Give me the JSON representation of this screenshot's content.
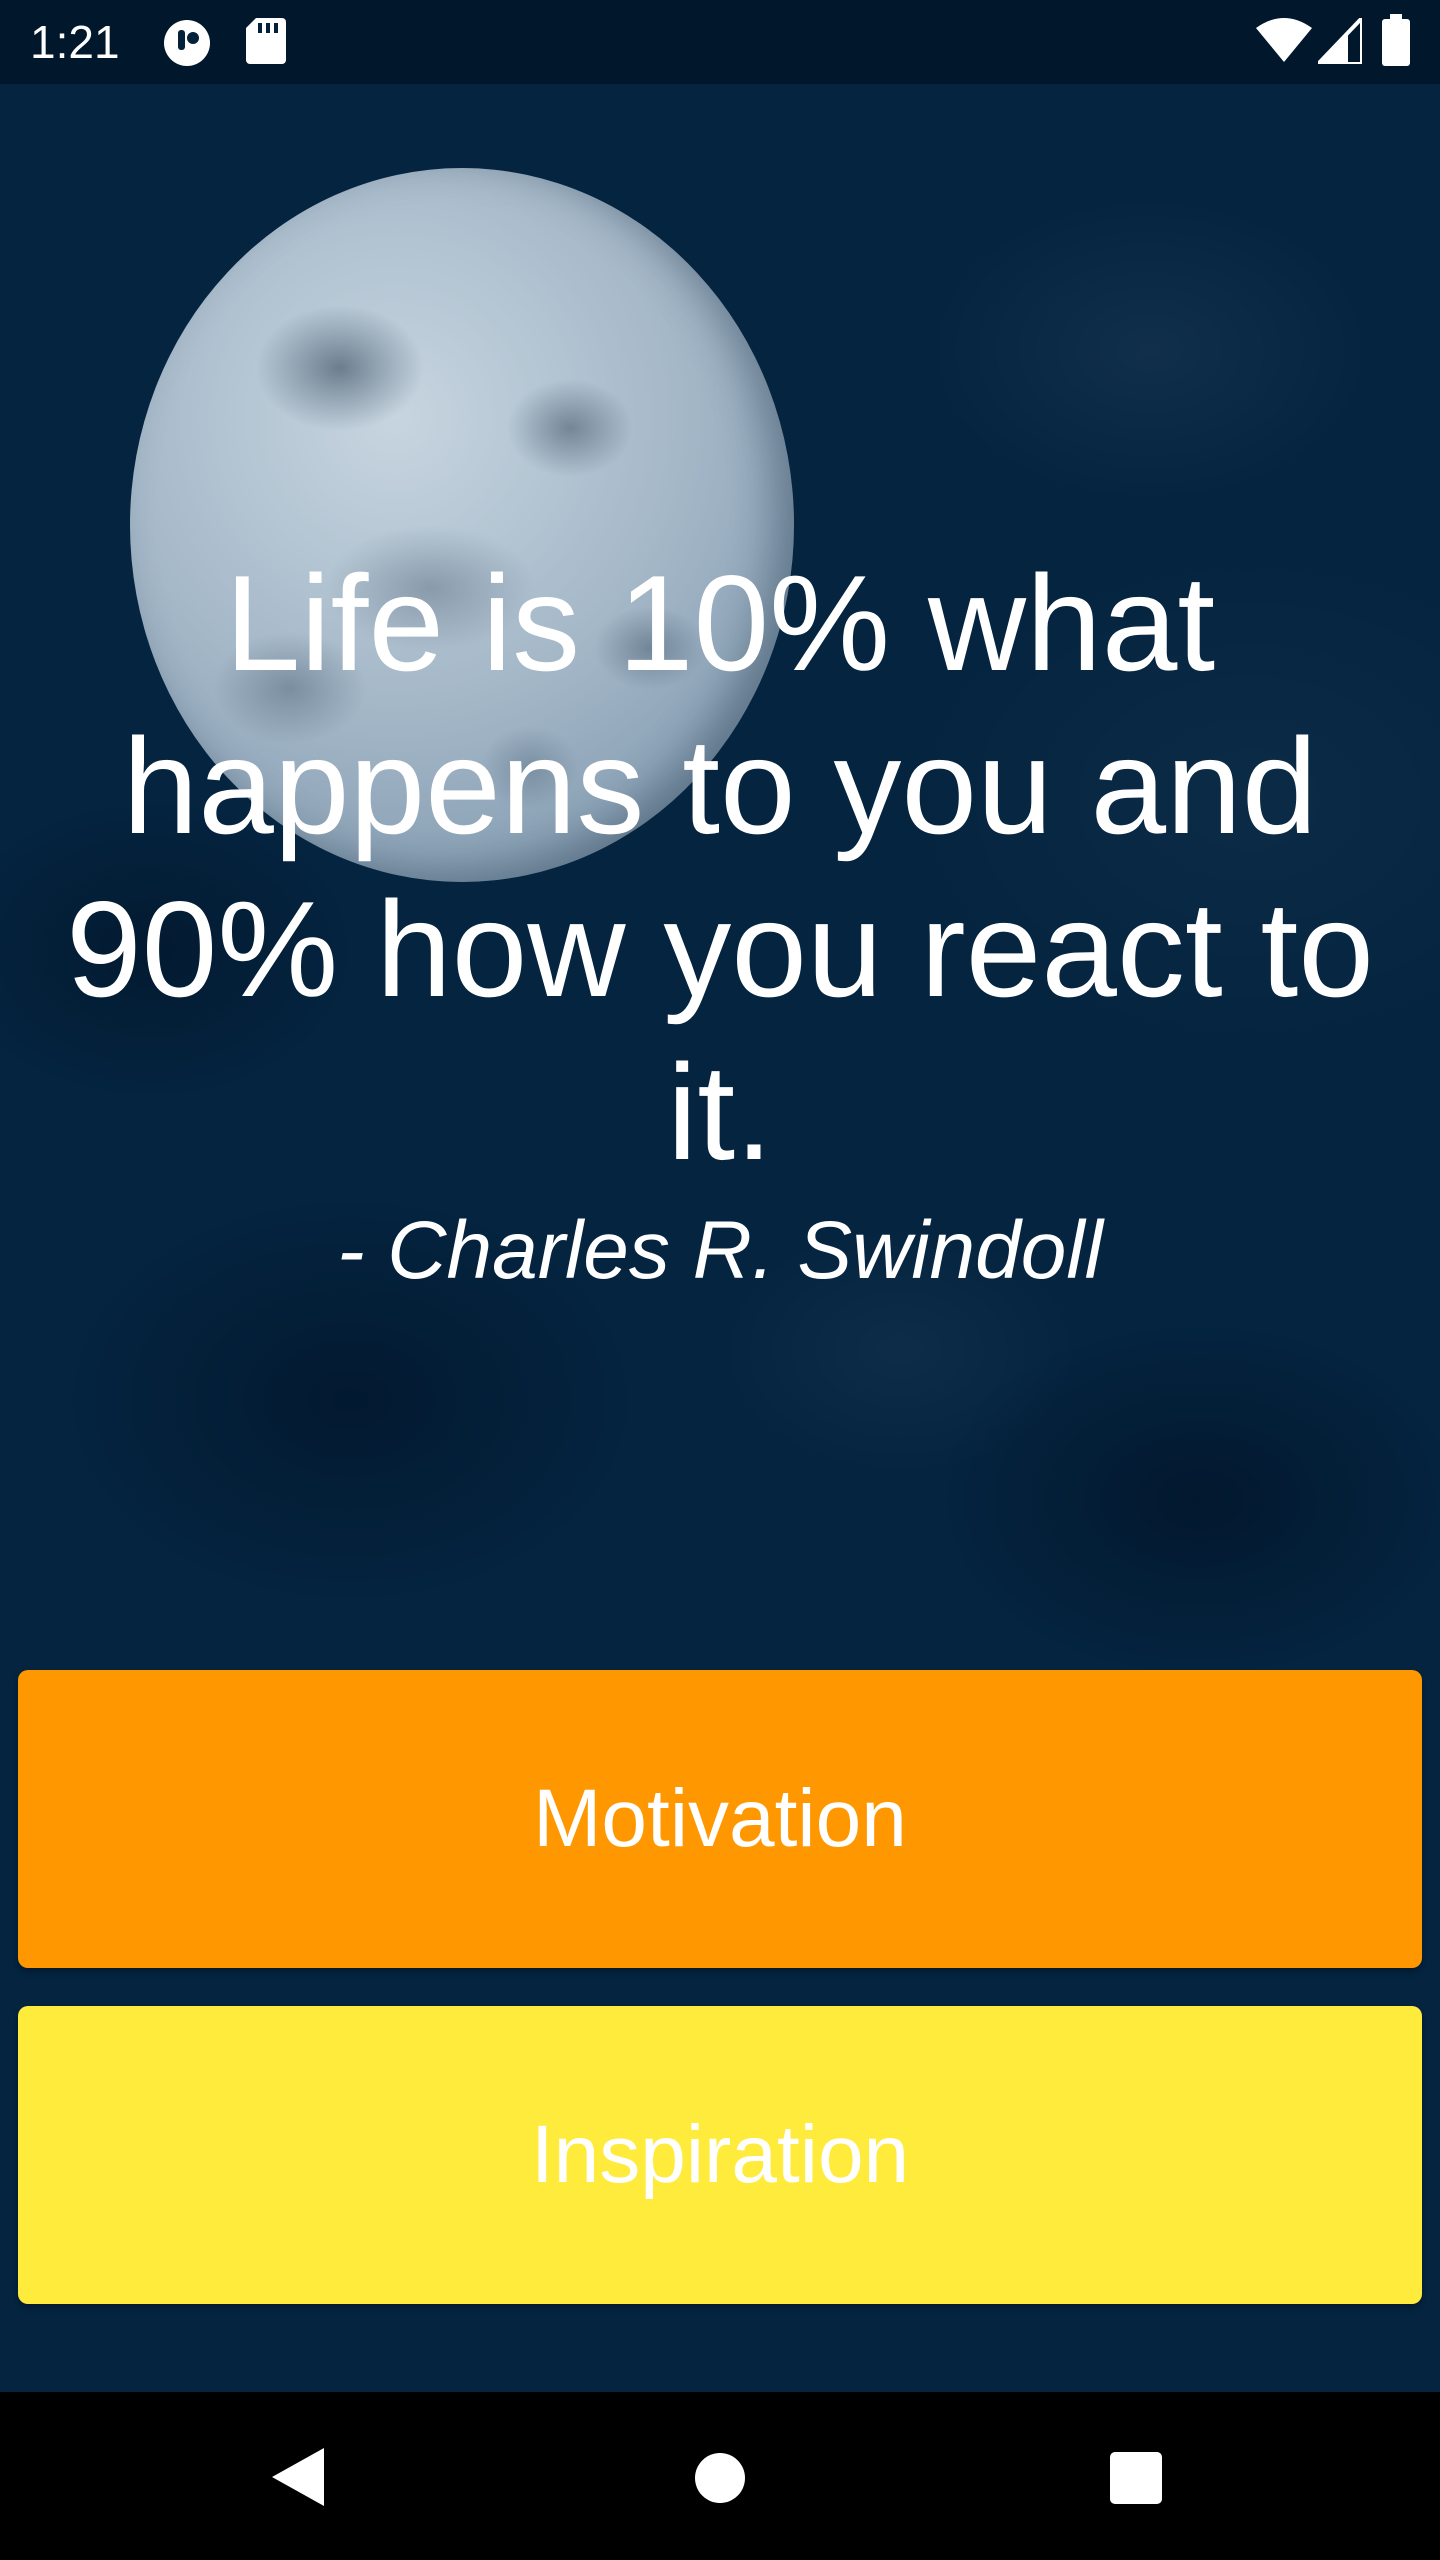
{
  "status_bar": {
    "time": "1:21",
    "icons": [
      "app-notification-icon",
      "sd-card-icon",
      "wifi-icon",
      "cell-signal-icon",
      "battery-icon"
    ]
  },
  "quote": {
    "text": "Life is 10% what happens to you and 90% how you react to it.",
    "author": "- Charles R. Swindoll"
  },
  "buttons": {
    "motivation": {
      "label": "Motivation",
      "color": "#ff9800"
    },
    "inspiration": {
      "label": "Inspiration",
      "color": "#ffeb3b"
    }
  },
  "nav_bar": {
    "icons": [
      "back-icon",
      "home-icon",
      "recents-icon"
    ]
  },
  "colors": {
    "background": "#042440",
    "text": "#ffffff"
  }
}
